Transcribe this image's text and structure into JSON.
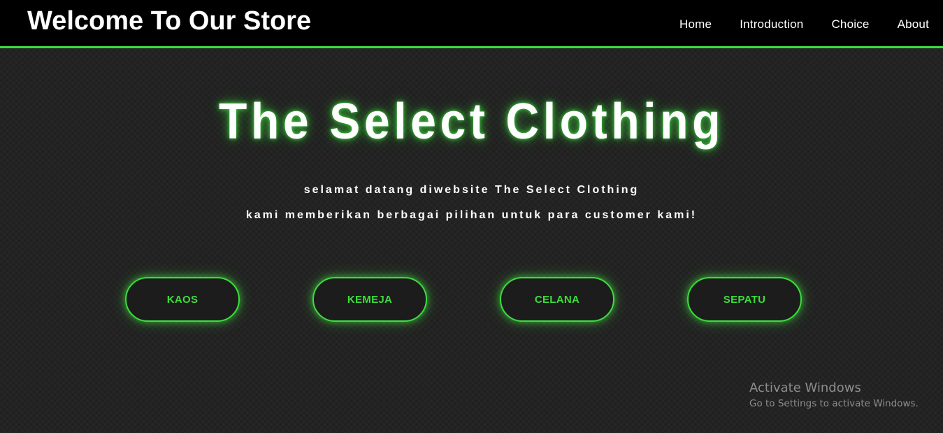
{
  "header": {
    "brand": "Welcome To Our Store",
    "nav": [
      "Home",
      "Introduction",
      "Choice",
      "About"
    ]
  },
  "hero": {
    "title": "The Select Clothing",
    "subtitle_line1": "selamat datang diwebsite The Select Clothing",
    "subtitle_line2": "kami memberikan berbagai pilihan untuk para customer kami!"
  },
  "categories": [
    "KAOS",
    "KEMEJA",
    "CELANA",
    "SEPATU"
  ],
  "watermark": {
    "title": "Activate Windows",
    "subtitle": "Go to Settings to activate Windows."
  },
  "colors": {
    "accent": "#3ddc3d",
    "background": "#232323",
    "header_background": "#000000",
    "text": "#ffffff"
  }
}
